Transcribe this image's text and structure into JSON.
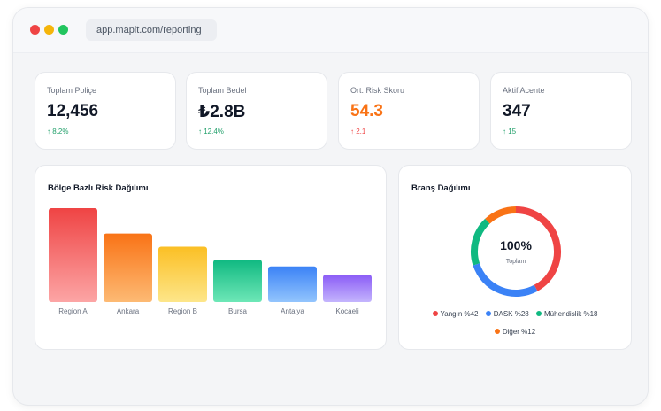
{
  "browser": {
    "url": "app.mapit.com/reporting"
  },
  "stats": [
    {
      "label": "Toplam Poliçe",
      "value": "12,456",
      "delta": "↑ 8.2%",
      "trend": "up",
      "value_color": "#111827"
    },
    {
      "label": "Toplam Bedel",
      "value": "₺2.8B",
      "delta": "↑ 12.4%",
      "trend": "up",
      "value_color": "#111827"
    },
    {
      "label": "Ort. Risk Skoru",
      "value": "54.3",
      "delta": "↑ 2.1",
      "trend": "up-negative",
      "value_color": "#f97316"
    },
    {
      "label": "Aktif Acente",
      "value": "347",
      "delta": "↑ 15",
      "trend": "up",
      "value_color": "#111827"
    }
  ],
  "risk_chart": {
    "title": "Bölge Bazlı Risk Dağılımı"
  },
  "branch_chart": {
    "title": "Branş Dağılımı",
    "center_value": "100%",
    "center_label": "Toplam",
    "legend": [
      {
        "label": "Yangın %42",
        "color": "#ef4444"
      },
      {
        "label": "DASK %28",
        "color": "#3b82f6"
      },
      {
        "label": "Mühendislik %18",
        "color": "#10b981"
      },
      {
        "label": "Diğer %12",
        "color": "#f97316"
      }
    ]
  },
  "chart_data": [
    {
      "type": "bar",
      "title": "Bölge Bazlı Risk Dağılımı",
      "categories": [
        "Region A",
        "Ankara",
        "Region B",
        "Bursa",
        "Antalya",
        "Kocaeli"
      ],
      "values": [
        100,
        73,
        59,
        45,
        38,
        29
      ],
      "ylim": [
        0,
        100
      ],
      "colors": [
        [
          "#ef4444",
          "#fca5a5"
        ],
        [
          "#f97316",
          "#fdba74"
        ],
        [
          "#fbbf24",
          "#fde68a"
        ],
        [
          "#10b981",
          "#6ee7b7"
        ],
        [
          "#3b82f6",
          "#93c5fd"
        ],
        [
          "#8b5cf6",
          "#c4b5fd"
        ]
      ],
      "grid": false
    },
    {
      "type": "pie",
      "title": "Branş Dağılımı",
      "categories": [
        "Yangın",
        "DASK",
        "Mühendislik",
        "Diğer"
      ],
      "values": [
        42,
        28,
        18,
        12
      ],
      "colors": [
        "#ef4444",
        "#3b82f6",
        "#10b981",
        "#f97316"
      ]
    }
  ]
}
